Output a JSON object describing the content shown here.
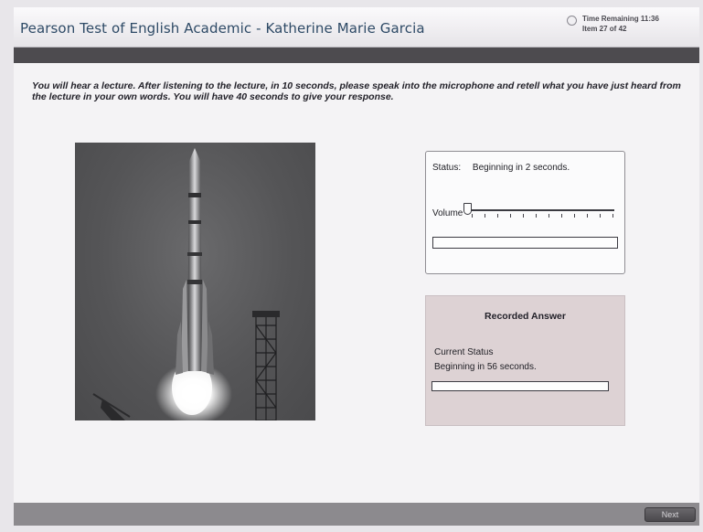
{
  "header": {
    "title": "Pearson Test of English Academic - Katherine Marie Garcia",
    "timer_label": "Time Remaining 11:36",
    "item_label": "Item 27 of 42"
  },
  "instructions": "You will hear a lecture. After listening to the lecture, in 10 seconds, please speak into the microphone and retell what you have just heard from the lecture in your own words. You will have 40 seconds to give your response.",
  "player": {
    "status_label": "Status:",
    "status_value": "Beginning in 2 seconds.",
    "volume_label": "Volume",
    "volume_level": 0,
    "playback_progress": 0
  },
  "recorder": {
    "title": "Recorded Answer",
    "current_status_label": "Current Status",
    "current_status_value": "Beginning in 56 seconds.",
    "recording_progress": 0
  },
  "footer": {
    "next_label": "Next"
  },
  "colors": {
    "title_text": "#2e4a66",
    "dark_bar": "#4d4b4f",
    "record_panel_bg": "#ddd2d4",
    "footer_bg": "#8c8a8e"
  },
  "icons": {
    "timer": "clock-icon"
  }
}
